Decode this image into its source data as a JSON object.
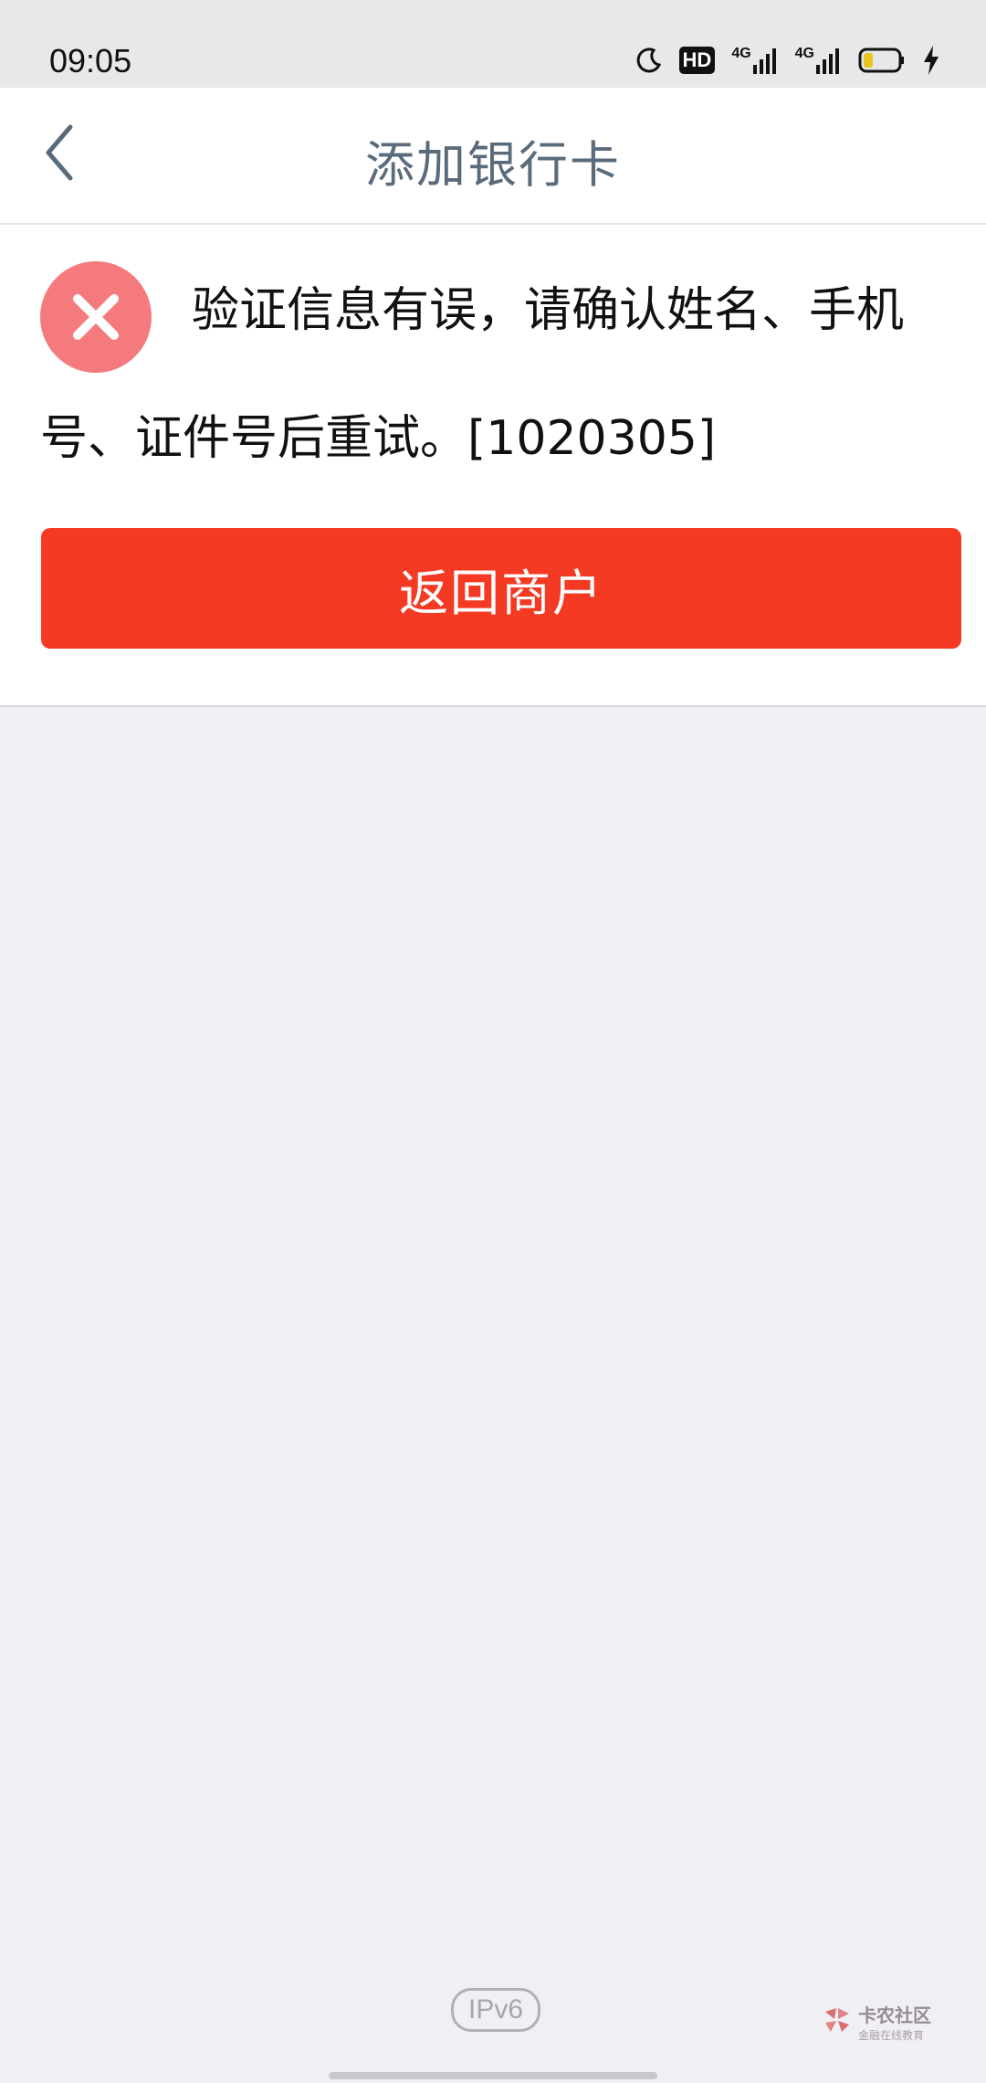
{
  "status_bar": {
    "time": "09:05",
    "icons": [
      "moon-icon",
      "hd-icon",
      "signal-4g-icon",
      "signal-4g-icon",
      "battery-icon",
      "charging-icon"
    ],
    "hd_label": "HD",
    "network_label_1": "4G",
    "network_label_2": "4G"
  },
  "nav": {
    "title": "添加银行卡",
    "back_icon": "chevron-left-icon"
  },
  "result": {
    "icon": "error-x-icon",
    "icon_color": "#f47a7e",
    "message": "验证信息有误，请确认姓名、手机号、证件号后重试。[1020305]",
    "button_label": "返回商户",
    "button_color": "#f43a23"
  },
  "footer": {
    "ipv6_label": "IPv6",
    "watermark_name": "卡农社区",
    "watermark_sub": "金融在线教育"
  }
}
